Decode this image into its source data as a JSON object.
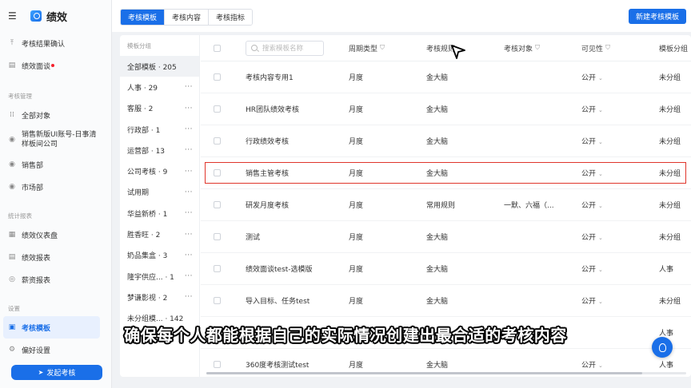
{
  "app": {
    "title": "绩效"
  },
  "sidebar": {
    "top_items": [
      {
        "label": "考核结果确认",
        "icon": "upload-icon"
      },
      {
        "label": "绩效面谈",
        "icon": "chat-icon",
        "dot": true
      }
    ],
    "section_manage": "考核管理",
    "manage_items": [
      {
        "label": "全部对象",
        "icon": "grid-icon"
      },
      {
        "label_line1": "销售新版UI账号-日事清",
        "label_line2": "样板间公司",
        "icon": "org-icon"
      },
      {
        "label": "销售部",
        "icon": "dept-icon"
      },
      {
        "label": "市场部",
        "icon": "dept-icon"
      }
    ],
    "section_stats": "统计报表",
    "stats_items": [
      {
        "label": "绩效仪表盘",
        "icon": "dashboard-icon"
      },
      {
        "label": "绩效报表",
        "icon": "report-icon"
      },
      {
        "label": "薪资报表",
        "icon": "salary-icon"
      }
    ],
    "section_settings": "设置",
    "settings_items": [
      {
        "label": "考核模板",
        "icon": "template-icon",
        "active": true
      },
      {
        "label": "偏好设置",
        "icon": "gear-icon"
      }
    ],
    "launch_button": "发起考核"
  },
  "tabs": [
    "考核模板",
    "考核内容",
    "考核指标"
  ],
  "new_template_button": "新建考核模板",
  "groups": {
    "header": "模板分组",
    "items": [
      {
        "label": "全部模板 · 205",
        "dots": false,
        "active": true
      },
      {
        "label": "人事 · 29",
        "dots": true
      },
      {
        "label": "客服 · 2",
        "dots": true
      },
      {
        "label": "行政部 · 1",
        "dots": true
      },
      {
        "label": "运营部 · 13",
        "dots": true
      },
      {
        "label": "公司考核 · 9",
        "dots": true
      },
      {
        "label": "试用期",
        "dots": true
      },
      {
        "label": "华益新桥 · 1",
        "dots": true
      },
      {
        "label": "胜香旺 · 2",
        "dots": true
      },
      {
        "label": "奶品集盒 · 3",
        "dots": true
      },
      {
        "label": "隆宇供应...  · 1",
        "dots": true
      },
      {
        "label": "梦谦影视 · 2",
        "dots": true
      },
      {
        "label": "未分组模... · 142",
        "dots": false
      }
    ]
  },
  "table": {
    "search_placeholder": "搜索模板名称",
    "columns": [
      "周期类型",
      "考核规则",
      "考核对象",
      "可见性",
      "模板分组"
    ],
    "rows": [
      {
        "name": "考核内容专用1",
        "period": "月度",
        "rule": "金大脑",
        "target": "",
        "visibility": "公开",
        "group": "未分组"
      },
      {
        "name": "HR团队绩效考核",
        "period": "月度",
        "rule": "金大脑",
        "target": "",
        "visibility": "公开",
        "group": "未分组"
      },
      {
        "name": "行政绩效考核",
        "period": "月度",
        "rule": "金大脑",
        "target": "",
        "visibility": "公开",
        "group": "未分组"
      },
      {
        "name": "销售主管考核",
        "period": "月度",
        "rule": "金大脑",
        "target": "",
        "visibility": "公开",
        "group": "未分组"
      },
      {
        "name": "研发月度考核",
        "period": "月度",
        "rule": "常用规则",
        "target": "一默、六福（...",
        "visibility": "公开",
        "group": "未分组"
      },
      {
        "name": "测试",
        "period": "月度",
        "rule": "金大脑",
        "target": "",
        "visibility": "公开",
        "group": "未分组"
      },
      {
        "name": "绩效面谈test-选模版",
        "period": "月度",
        "rule": "金大脑",
        "target": "",
        "visibility": "公开",
        "group": "人事"
      },
      {
        "name": "导入目标、任务test",
        "period": "月度",
        "rule": "金大脑",
        "target": "",
        "visibility": "公开",
        "group": "未分组"
      },
      {
        "name": "",
        "period": "",
        "rule": "",
        "target": "",
        "visibility": "",
        "group": "人事"
      },
      {
        "name": "360度考核测试test",
        "period": "月度",
        "rule": "金大脑",
        "target": "",
        "visibility": "公开",
        "group": "人事"
      }
    ]
  },
  "subtitle": "确保每个人都能根据自己的实际情况创建出最合适的考核内容",
  "colors": {
    "accent": "#1a6fe8",
    "highlight": "#e0352b"
  }
}
